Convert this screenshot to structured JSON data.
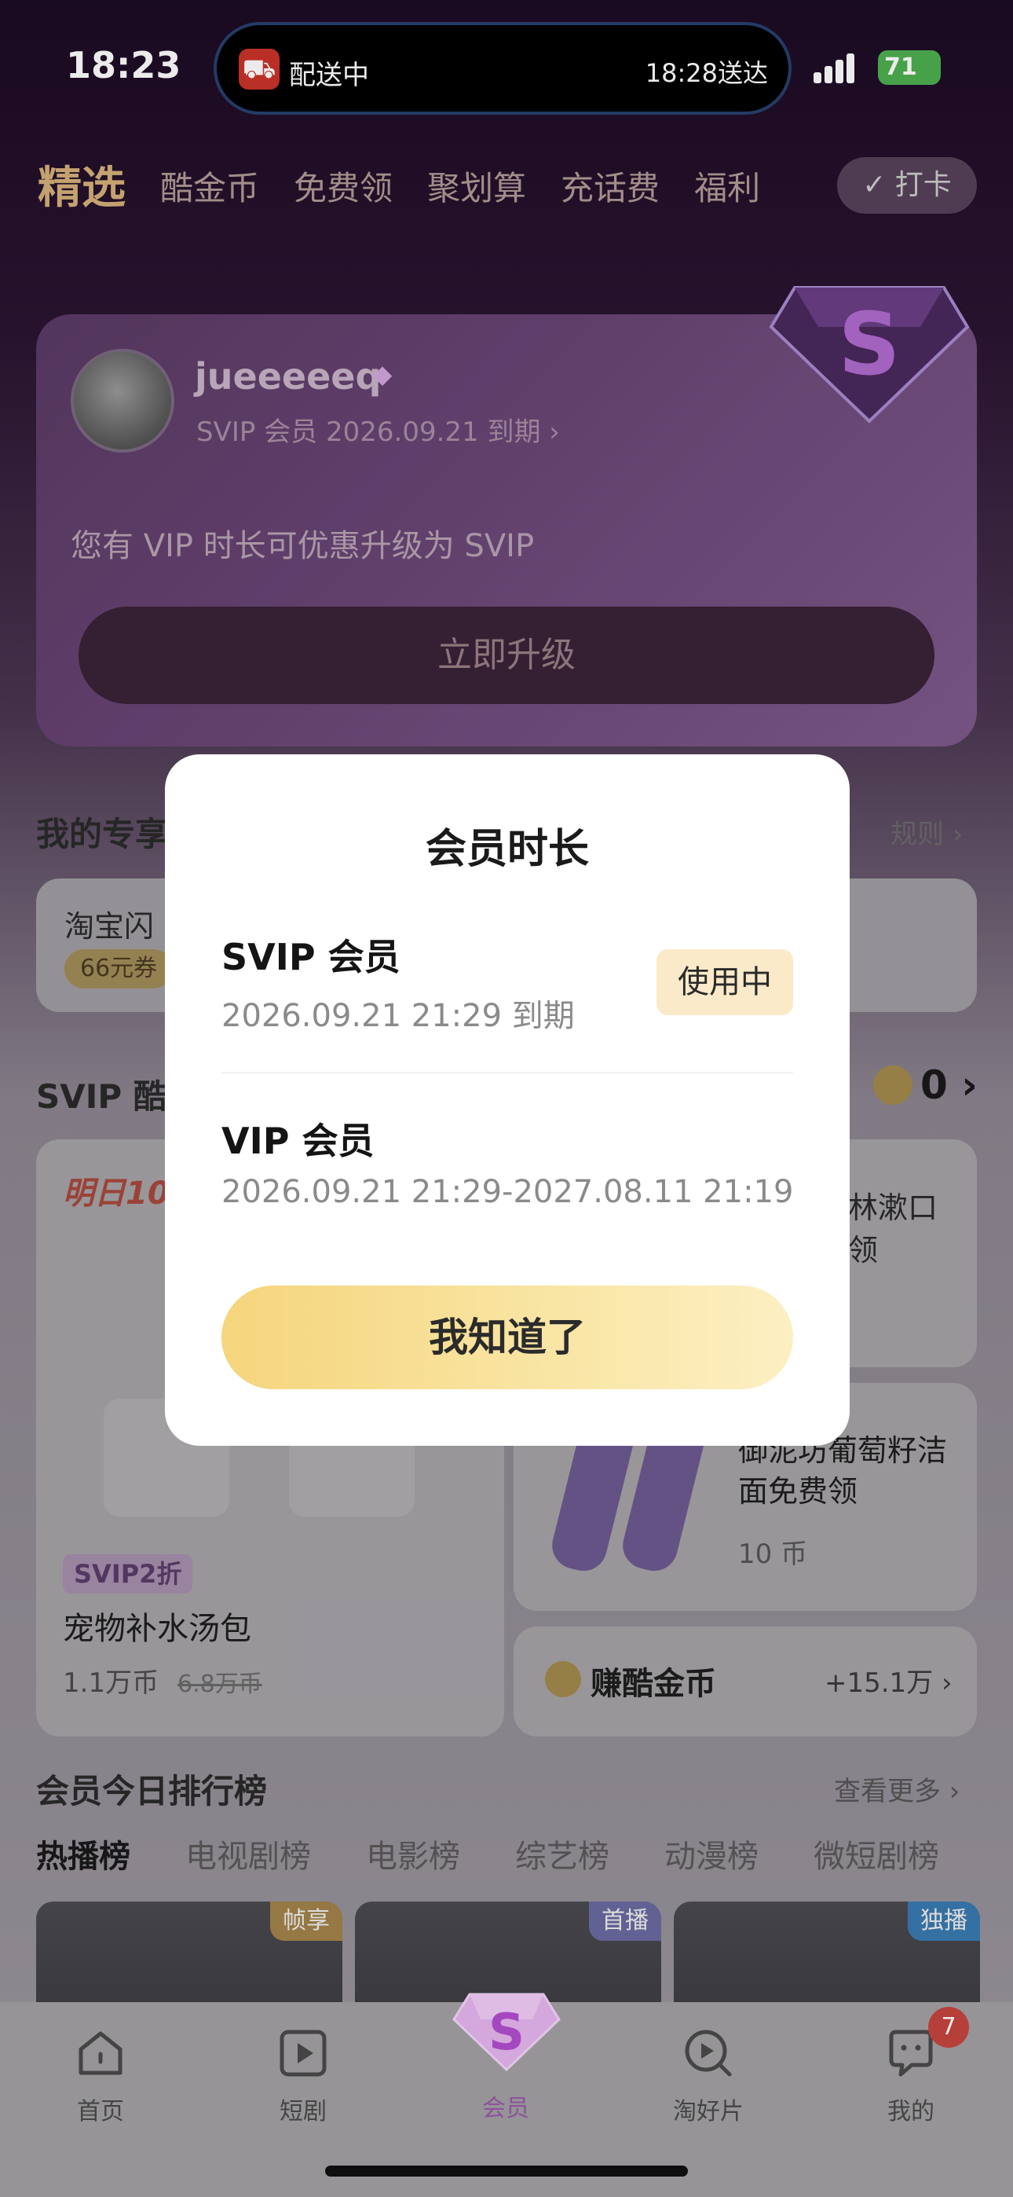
{
  "status_bar": {
    "time": "18:23",
    "island_left": "配送中",
    "island_right": "18:28送达",
    "battery": "71"
  },
  "category_tabs": [
    "精选",
    "酷金币",
    "免费领",
    "聚划算",
    "充话费",
    "福利"
  ],
  "checkin_label": "✓ 打卡",
  "member_card": {
    "username": "jueeeeeq",
    "expire_line": "SVIP 会员 2026.09.21 到期 ›",
    "upgrade_tip": "您有 VIP 时长可优惠升级为 SVIP",
    "upgrade_button": "立即升级"
  },
  "background": {
    "exclusive_title": "我的专享",
    "rules_link": "规则 ›",
    "exclusive_item": "淘宝闪",
    "exclusive_coupon": "66元券",
    "svip_section_title": "SVIP 酷",
    "coin_balance": "0 ›",
    "promo_red": "明日10",
    "svip_badge": "SVIP2折",
    "product_name": "宠物补水汤包",
    "product_price": "1.1万币",
    "product_old_price": "6.8万币",
    "right_top_text": "林漱口\n领",
    "right_mid_text": "御泥坊葡萄籽洁面免费领",
    "right_mid_coins": "10 币",
    "earn_label": "赚酷金币",
    "earn_value": "+15.1万 ›",
    "ranking_title": "会员今日排行榜",
    "ranking_more": "查看更多 ›",
    "ranking_tabs": [
      "热播榜",
      "电视剧榜",
      "电影榜",
      "综艺榜",
      "动漫榜",
      "微短剧榜"
    ],
    "thumb_tags": [
      "帧享",
      "首播",
      "独播"
    ]
  },
  "dialog": {
    "title": "会员时长",
    "svip_name": "SVIP 会员",
    "svip_date": "2026.09.21 21:29 到期",
    "in_use": "使用中",
    "vip_name": "VIP 会员",
    "vip_date": "2026.09.21 21:29-2027.08.11 21:19",
    "ok_button": "我知道了"
  },
  "tab_bar": {
    "items": [
      "首页",
      "短剧",
      "会员",
      "淘好片",
      "我的"
    ],
    "badge": "7"
  }
}
